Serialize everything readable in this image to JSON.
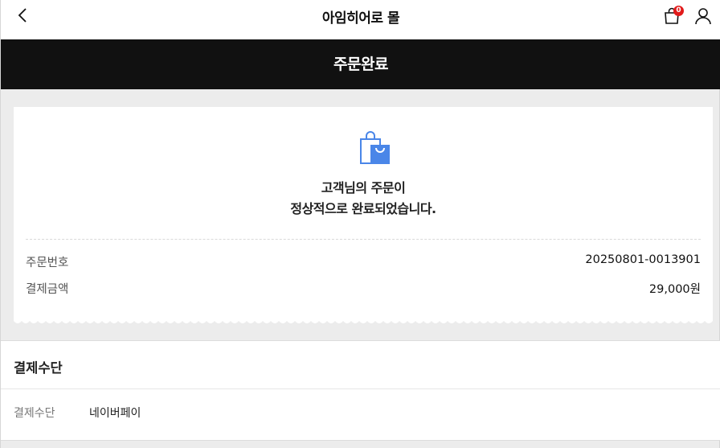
{
  "header": {
    "title": "아임히어로 몰",
    "cart_count": "0",
    "icons": {
      "back": "chevron-left-icon",
      "cart": "shopping-bag-icon",
      "user": "user-icon"
    },
    "badge_color": "#e21b1b"
  },
  "page": {
    "title": "주문완료",
    "header_bg": "#111111"
  },
  "receipt": {
    "icon": "shopping-bag-icon",
    "icon_color": "#4a86e8",
    "message_line1": "고객님의 주문이",
    "message_line2": "정상적으로 완료되었습니다.",
    "order_number_label": "주문번호",
    "order_number": "20250801-0013901",
    "amount_label": "결제금액",
    "amount": "29,000원"
  },
  "payment": {
    "section_title": "결제수단",
    "method_label": "결제수단",
    "method_value": "네이버페이"
  }
}
